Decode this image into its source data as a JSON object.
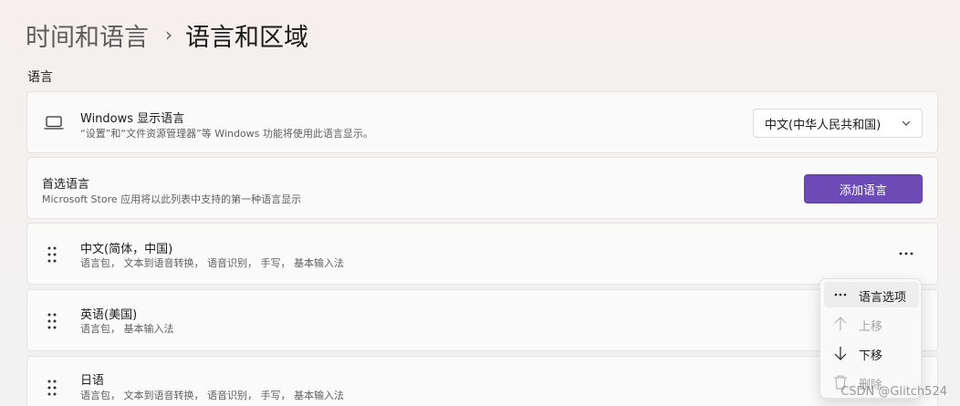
{
  "breadcrumb": {
    "parent": "时间和语言",
    "separator": "›",
    "current": "语言和区域"
  },
  "section": {
    "title": "语言"
  },
  "display_language": {
    "icon": "laptop-icon",
    "title": "Windows 显示语言",
    "subtitle": "“设置”和“文件资源管理器”等 Windows 功能将使用此语言显示。",
    "dropdown_value": "中文(中华人民共和国)"
  },
  "preferred": {
    "title": "首选语言",
    "subtitle": "Microsoft Store 应用将以此列表中支持的第一种语言显示",
    "add_button": "添加语言"
  },
  "languages": [
    {
      "name": "中文(简体，中国)",
      "features": "语言包， 文本到语音转换， 语音识别， 手写， 基本输入法"
    },
    {
      "name": "英语(美国)",
      "features": "语言包， 基本输入法"
    },
    {
      "name": "日语",
      "features": "语言包， 文本到语音转换， 语音识别， 手写， 基本输入法"
    }
  ],
  "context_menu": {
    "items": [
      {
        "label": "语言选项",
        "icon": "more-icon",
        "disabled": false
      },
      {
        "label": "上移",
        "icon": "arrow-up-icon",
        "disabled": true
      },
      {
        "label": "下移",
        "icon": "arrow-down-icon",
        "disabled": false
      },
      {
        "label": "删除",
        "icon": "trash-icon",
        "disabled": true
      }
    ]
  },
  "watermark": "CSDN @Glitch524",
  "colors": {
    "accent": "#6c4bb6",
    "background": "#f3f1f0",
    "card": "#fbfbfb"
  }
}
